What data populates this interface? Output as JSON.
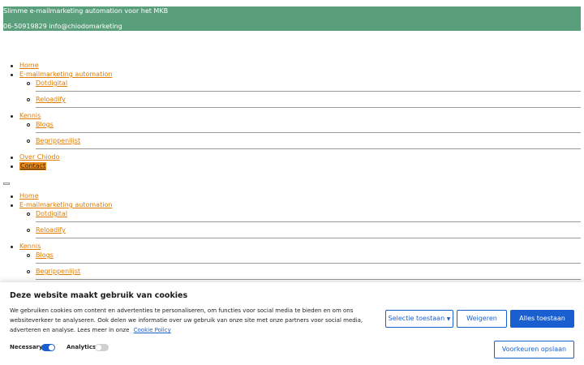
{
  "topbar": {
    "tagline": "Slimme e-mailmarketing automation voor het MKB",
    "contact_line": "06-50919829 info@chiodomarketing"
  },
  "nav1": {
    "home": "Home",
    "emailmarketing": "E-mailmarketing automation",
    "dotdigital": "Dotdigital",
    "reloadify": "Reloadify",
    "kennis": "Kennis",
    "blogs": "Blogs",
    "begrippenlijst": "Begrippenlijst",
    "over": "Over Chiodo",
    "contact": "Contact"
  },
  "nav2": {
    "home": "Home",
    "emailmarketing": "E-mailmarketing automation",
    "dotdigital": "Dotdigital",
    "reloadify": "Reloadify",
    "kennis": "Kennis",
    "blogs": "Blogs",
    "begrippenlijst": "Begrippenlijst"
  },
  "cookie": {
    "title": "Deze website maakt gebruik van cookies",
    "text": "We gebruiken cookies om content en advertenties te personaliseren, om functies voor social media te bieden en om ons websiteverkeer te analyseren. Ook delen we informatie over uw gebruik van onze site met onze partners voor social media, adverteren en analyse. Lees meer in onze",
    "policy_link": "Cookie Policy",
    "btn_selection": "Selectie toestaan",
    "btn_refuse": "Weigeren",
    "btn_allow_all": "Alles toestaan",
    "btn_save": "Voorkeuren opslaan",
    "necessary_label": "Necessary",
    "analytics_label": "Analytics",
    "colors": {
      "accent": "#1a5fd0",
      "toggle_on": "#1a5fd0",
      "toggle_off": "#d0d0d0"
    }
  }
}
